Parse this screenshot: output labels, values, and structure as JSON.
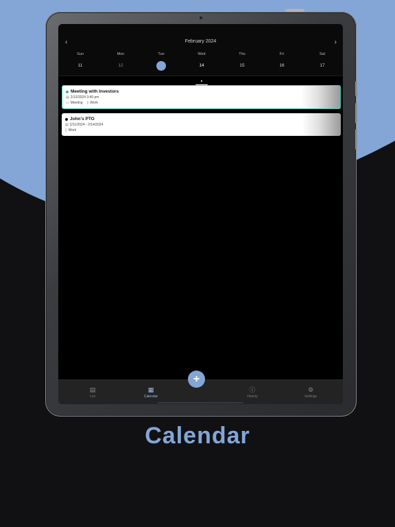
{
  "calendar": {
    "month_title": "February 2024",
    "prev_label": "‹",
    "next_label": "›",
    "days": [
      {
        "name": "Sun",
        "num": "11"
      },
      {
        "name": "Mon",
        "num": "12"
      },
      {
        "name": "Tue",
        "num": "13"
      },
      {
        "name": "Wed",
        "num": "14"
      },
      {
        "name": "Thu",
        "num": "15"
      },
      {
        "name": "Fri",
        "num": "16"
      },
      {
        "name": "Sat",
        "num": "17"
      }
    ]
  },
  "events": [
    {
      "title": "Meeting with Investors",
      "status_color": "#2ab795",
      "datetime": "2/13/2024 3:40 pm",
      "category": "Meeting",
      "tag": "Work"
    },
    {
      "title": "John's PTO",
      "status_color": "#111111",
      "datetime": "2/11/2024 - 2/14/2024",
      "tag": "Work"
    }
  ],
  "tabs": {
    "list": {
      "label": "List",
      "icon": "list-icon"
    },
    "calendar": {
      "label": "Calendar",
      "icon": "calendar-icon"
    },
    "history": {
      "label": "History",
      "icon": "history-icon"
    },
    "settings": {
      "label": "Settings",
      "icon": "gear-icon"
    }
  },
  "fab": {
    "label": "+"
  },
  "caption": "Calendar",
  "colors": {
    "accent": "#84a6d6",
    "active_border": "#35c6b3",
    "background": "#111113"
  }
}
